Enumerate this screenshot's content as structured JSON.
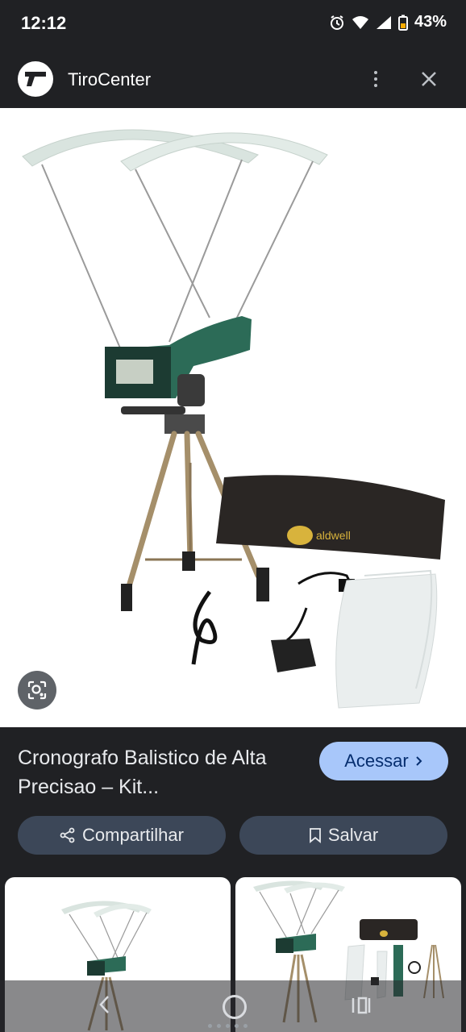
{
  "status": {
    "time": "12:12",
    "battery": "43%"
  },
  "header": {
    "site_name": "TiroCenter"
  },
  "result": {
    "title": "Cronografo Balistico de Alta Precisao – Kit...",
    "visit_label": "Acessar",
    "share_label": "Compartilhar",
    "save_label": "Salvar"
  },
  "icons": [
    "site-logo-icon",
    "more-vert-icon",
    "close-icon",
    "lens-icon",
    "share-icon",
    "bookmark-icon",
    "chevron-right-icon",
    "back-icon",
    "home-icon",
    "recents-icon",
    "alarm-icon",
    "wifi-icon",
    "signal-icon",
    "battery-icon"
  ],
  "colors": {
    "background": "#202124",
    "visit_button": "#a8c7fa",
    "action_button": "#3c4758"
  }
}
